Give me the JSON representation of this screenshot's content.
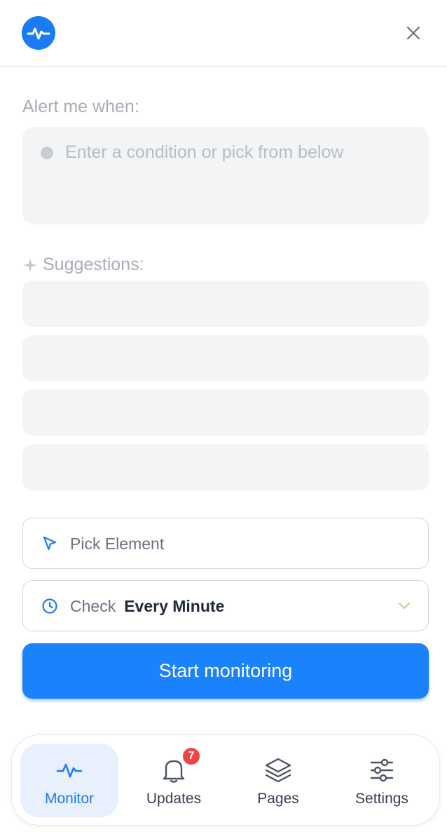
{
  "header": {
    "logo_icon": "pulse-icon",
    "close_icon": "close-icon"
  },
  "alert": {
    "label": "Alert me when:",
    "placeholder": "Enter a condition or pick from below"
  },
  "suggestions": {
    "label": "Suggestions:",
    "icon": "sparkle-icon",
    "items": [
      "",
      "",
      "",
      ""
    ]
  },
  "pick_element": {
    "icon": "cursor-pointer-icon",
    "label": "Pick Element"
  },
  "check_frequency": {
    "icon": "clock-icon",
    "prefix": "Check",
    "value": "Every Minute"
  },
  "start_button": {
    "label": "Start monitoring"
  },
  "nav": {
    "items": [
      {
        "label": "Monitor",
        "icon": "pulse-icon",
        "active": true
      },
      {
        "label": "Updates",
        "icon": "bell-icon",
        "badge": "7"
      },
      {
        "label": "Pages",
        "icon": "layers-icon"
      },
      {
        "label": "Settings",
        "icon": "sliders-icon"
      }
    ]
  },
  "colors": {
    "accent": "#1a82fb",
    "badge": "#ef4444"
  }
}
